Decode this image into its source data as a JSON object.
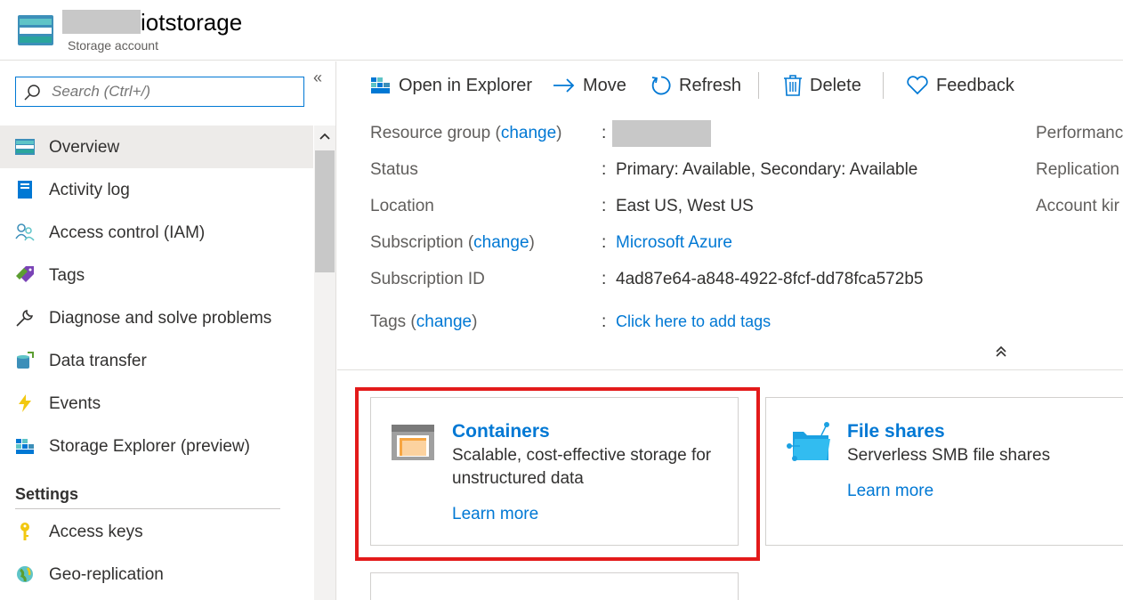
{
  "header": {
    "title": "iotstorage",
    "subtitle": "Storage account"
  },
  "sidebar": {
    "search_placeholder": "Search (Ctrl+/)",
    "collapse_glyph": "«",
    "items": [
      {
        "label": "Overview",
        "icon": "storage-overview-icon",
        "active": true
      },
      {
        "label": "Activity log",
        "icon": "activity-log-icon"
      },
      {
        "label": "Access control (IAM)",
        "icon": "people-icon"
      },
      {
        "label": "Tags",
        "icon": "tag-icon"
      },
      {
        "label": "Diagnose and solve problems",
        "icon": "wrench-icon"
      },
      {
        "label": "Data transfer",
        "icon": "data-transfer-icon"
      },
      {
        "label": "Events",
        "icon": "lightning-icon"
      },
      {
        "label": "Storage Explorer (preview)",
        "icon": "storage-explorer-icon"
      }
    ],
    "section_settings": "Settings",
    "settings_items": [
      {
        "label": "Access keys",
        "icon": "key-icon"
      },
      {
        "label": "Geo-replication",
        "icon": "globe-icon"
      }
    ]
  },
  "toolbar": {
    "open_in_explorer": "Open in Explorer",
    "move": "Move",
    "refresh": "Refresh",
    "delete": "Delete",
    "feedback": "Feedback"
  },
  "essentials": {
    "resource_group_label": "Resource group",
    "change": "change",
    "status_label": "Status",
    "status_value": "Primary: Available, Secondary: Available",
    "location_label": "Location",
    "location_value": "East US, West US",
    "subscription_label": "Subscription",
    "subscription_value": "Microsoft Azure",
    "subscription_id_label": "Subscription ID",
    "subscription_id_value": "4ad87e64-a848-4922-8fcf-dd78fca572b5",
    "tags_label": "Tags",
    "tags_value": "Click here to add tags",
    "colon": ":",
    "right_performance": "Performanc",
    "right_replication": "Replication",
    "right_account_kind": "Account kir"
  },
  "cards": {
    "containers": {
      "title": "Containers",
      "desc_line1": "Scalable, cost-effective storage for",
      "desc_line2": "unstructured data",
      "link": "Learn more"
    },
    "file_shares": {
      "title": "File shares",
      "desc": "Serverless SMB file shares",
      "link": "Learn more"
    }
  },
  "colors": {
    "accent": "#0078d4",
    "highlight": "#e31a1a"
  }
}
